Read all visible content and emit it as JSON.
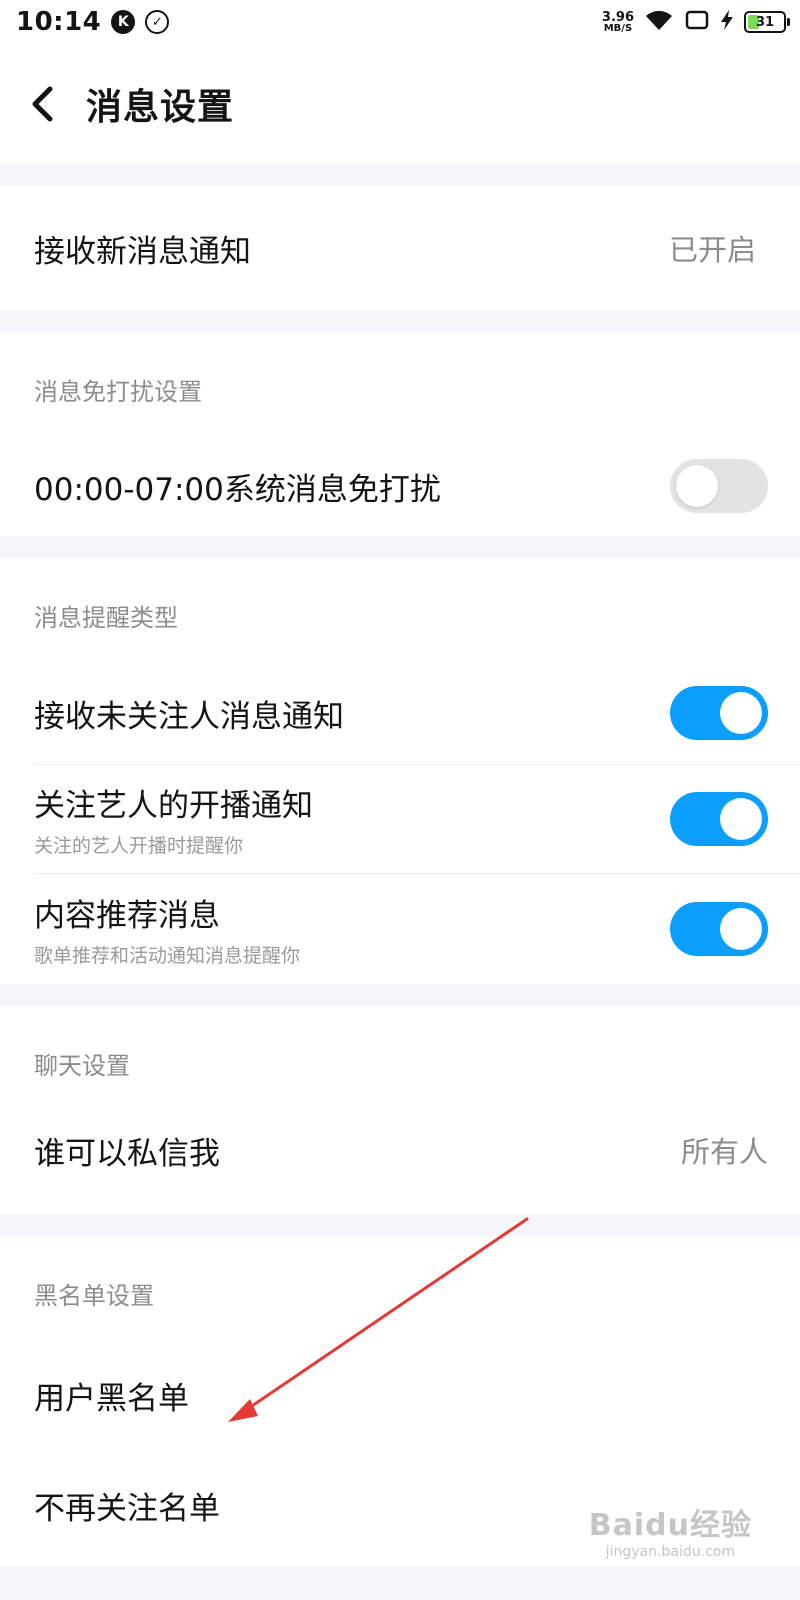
{
  "status_bar": {
    "time": "10:14",
    "badge_k": "K",
    "network_speed_value": "3.96",
    "network_speed_unit": "MB/S",
    "battery": "31"
  },
  "header": {
    "title": "消息设置"
  },
  "notification": {
    "label": "接收新消息通知",
    "value": "已开启"
  },
  "dnd": {
    "section_label": "消息免打扰设置",
    "label": "00:00-07:00系统消息免打扰",
    "enabled": false
  },
  "reminder_types": {
    "section_label": "消息提醒类型",
    "items": [
      {
        "label": "接收未关注人消息通知",
        "sub": "",
        "enabled": true
      },
      {
        "label": "关注艺人的开播通知",
        "sub": "关注的艺人开播时提醒你",
        "enabled": true
      },
      {
        "label": "内容推荐消息",
        "sub": "歌单推荐和活动通知消息提醒你",
        "enabled": true
      }
    ]
  },
  "chat": {
    "section_label": "聊天设置",
    "dm_label": "谁可以私信我",
    "dm_value": "所有人"
  },
  "blacklist": {
    "section_label": "黑名单设置",
    "user_blacklist": "用户黑名单",
    "unfollow_list": "不再关注名单"
  },
  "annotation_color": "#e53935",
  "toggle_on_color": "#0b9efc",
  "watermark": {
    "top": "Baidu经验",
    "bottom": "jingyan.baidu.com"
  }
}
